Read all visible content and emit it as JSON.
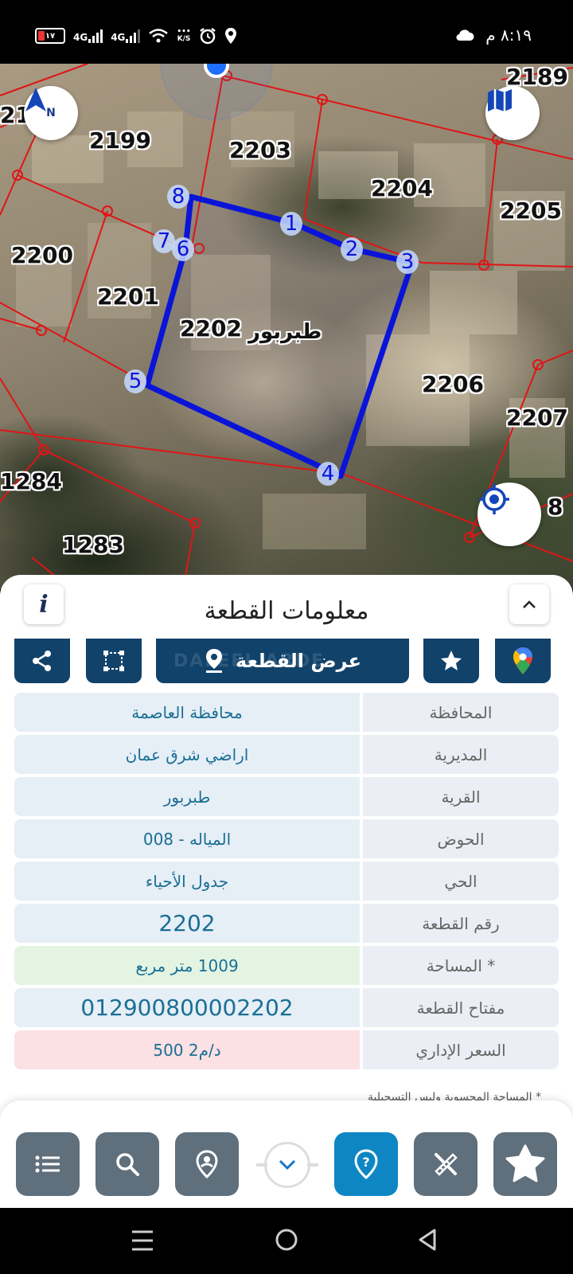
{
  "status_bar": {
    "time": "٨:١٩ م",
    "battery": "١٧",
    "network_1": "4G",
    "network_2": "4G",
    "speed_unit": "K/S"
  },
  "map": {
    "parcels": [
      {
        "label": "2189"
      },
      {
        "label": "2199"
      },
      {
        "label": "2203"
      },
      {
        "label": "2204"
      },
      {
        "label": "2205"
      },
      {
        "label": "2200"
      },
      {
        "label": "2201"
      },
      {
        "label": "2202"
      },
      {
        "label": "2206"
      },
      {
        "label": "2207"
      },
      {
        "label": "1284"
      },
      {
        "label": "1283"
      },
      {
        "label": "21"
      },
      {
        "label": "8"
      }
    ],
    "village_label": "طبربور",
    "vertices": [
      "1",
      "2",
      "3",
      "4",
      "5",
      "6",
      "7",
      "8"
    ],
    "north_label": "N"
  },
  "sheet": {
    "title": "معلومات القطعة",
    "info_label": "i",
    "show_parcel_label": "عرض القطعة",
    "watermark": "DALEEL ARDE",
    "rows": [
      {
        "label": "المحافظة",
        "value": "محافظة العاصمة"
      },
      {
        "label": "المديرية",
        "value": "اراضي شرق عمان"
      },
      {
        "label": "القرية",
        "value": "طبربور"
      },
      {
        "label": "الحوض",
        "value": "المياله - 008"
      },
      {
        "label": "الحي",
        "value": "جدول الأحياء"
      },
      {
        "label": "رقم القطعة",
        "value": "2202"
      },
      {
        "label": "المساحة *",
        "value": "1009  متر مربع"
      },
      {
        "label": "مفتاح القطعة",
        "value": "012900800002202"
      },
      {
        "label": "السعر الإداري",
        "value": "500 د/م2"
      }
    ],
    "footnote": "* المساحة المحسوبة وليس التسجيلية"
  },
  "colors": {
    "primary": "#11426a",
    "active": "#0f86c4",
    "nav_button": "#5f6f7c",
    "parcel_line": "#e01515",
    "selected_parcel": "#0a14d8",
    "value_text": "#1a6f95"
  },
  "icons": {
    "share": "share-icon",
    "polygon": "polygon-icon",
    "pin": "map-pin-icon",
    "star": "star-icon",
    "google_maps": "google-maps-icon",
    "list": "list-icon",
    "search": "search-icon",
    "location_person": "location-person-icon",
    "help": "help-icon",
    "tools": "tools-icon",
    "favorite": "star-badge-icon"
  }
}
